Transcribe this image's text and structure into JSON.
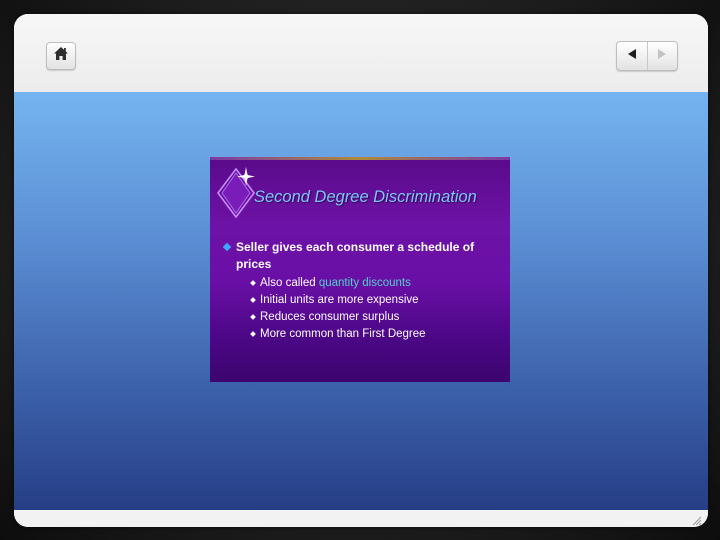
{
  "toolbar": {
    "home_icon": "home-icon",
    "prev_icon": "triangle-left-icon",
    "next_icon": "triangle-right-icon"
  },
  "slide": {
    "title": "Second Degree Discrimination",
    "main_bullet": "Seller gives each consumer a schedule of prices",
    "sub_bullets": [
      {
        "prefix": "Also called ",
        "highlight": "quantity discounts"
      },
      {
        "prefix": "Initial units are more expensive",
        "highlight": ""
      },
      {
        "prefix": "Reduces consumer surplus",
        "highlight": ""
      },
      {
        "prefix": "More common than First Degree",
        "highlight": ""
      }
    ]
  },
  "colors": {
    "stage_top": "#75b4f0",
    "stage_bottom": "#263e86",
    "slide_bg": "#6d12a6",
    "title_color": "#7fc4ff",
    "highlight_color": "#4fd0c8"
  }
}
